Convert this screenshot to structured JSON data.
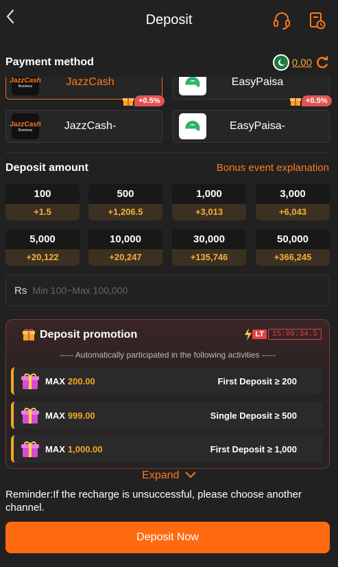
{
  "header": {
    "title": "Deposit",
    "back_icon": "chevron-left-icon"
  },
  "payment": {
    "title": "Payment method",
    "balance": "0.00",
    "methods_top": [
      "JazzCash",
      "EasyPaisa"
    ],
    "methods": [
      {
        "name": "JazzCash-",
        "bonus": "+0.5%"
      },
      {
        "name": "EasyPaisa-",
        "bonus": "+0.5%"
      }
    ],
    "jc_logo_text": "JazzCash",
    "jc_logo_sub": "Business"
  },
  "amount": {
    "title": "Deposit amount",
    "bonus_link": "Bonus event explanation",
    "options": [
      {
        "value": "100",
        "bonus": "+1.5"
      },
      {
        "value": "500",
        "bonus": "+1,206.5"
      },
      {
        "value": "1,000",
        "bonus": "+3,013"
      },
      {
        "value": "3,000",
        "bonus": "+6,043"
      },
      {
        "value": "5,000",
        "bonus": "+20,122"
      },
      {
        "value": "10,000",
        "bonus": "+20,247"
      },
      {
        "value": "30,000",
        "bonus": "+135,746"
      },
      {
        "value": "50,000",
        "bonus": "+366,245"
      }
    ],
    "currency": "Rs",
    "placeholder": "Min 100~Max 100,000"
  },
  "promotion": {
    "title": "Deposit promotion",
    "lt_label": "LT",
    "timer": "15:09:34.5",
    "subtitle": "----- Automatically participated in the following activities -----",
    "items": [
      {
        "max_label": "MAX",
        "max_value": "200.00",
        "condition": "First Deposit ≥ 200"
      },
      {
        "max_label": "MAX",
        "max_value": "999.00",
        "condition": "Single Deposit ≥ 500"
      },
      {
        "max_label": "MAX",
        "max_value": "1,000.00",
        "condition": "First Deposit ≥ 1,000"
      }
    ]
  },
  "expand_label": "Expand",
  "reminder": "Reminder:If the recharge is unsuccessful, please choose another channel.",
  "deposit_button": "Deposit Now",
  "colors": {
    "accent": "#ff6a10",
    "gold": "#f5a623",
    "bonus_red": "#e25454"
  }
}
